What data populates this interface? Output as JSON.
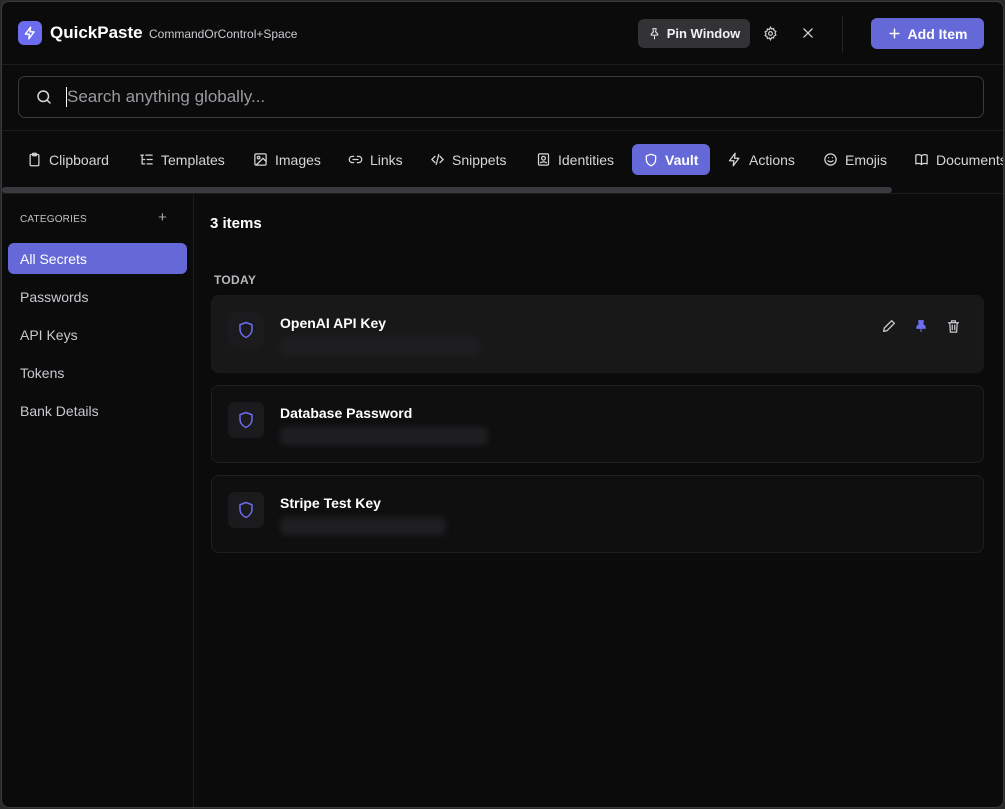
{
  "app": {
    "title": "QuickPaste",
    "hotkey": "CommandOrControl+Space"
  },
  "header": {
    "pin_label": "Pin Window",
    "add_label": "Add Item"
  },
  "search": {
    "placeholder": "Search anything globally..."
  },
  "tabs": [
    {
      "label": "Clipboard",
      "icon": "clipboard-icon"
    },
    {
      "label": "Templates",
      "icon": "list-tree-icon"
    },
    {
      "label": "Images",
      "icon": "image-icon"
    },
    {
      "label": "Links",
      "icon": "link-icon"
    },
    {
      "label": "Snippets",
      "icon": "code-icon"
    },
    {
      "label": "Identities",
      "icon": "id-card-icon"
    },
    {
      "label": "Vault",
      "icon": "shield-icon",
      "active": true
    },
    {
      "label": "Actions",
      "icon": "bolt-icon"
    },
    {
      "label": "Emojis",
      "icon": "smile-icon"
    },
    {
      "label": "Documents",
      "icon": "book-icon"
    }
  ],
  "sidebar": {
    "heading": "CATEGORIES",
    "add_symbol": "+",
    "items": [
      {
        "label": "All Secrets",
        "active": true
      },
      {
        "label": "Passwords"
      },
      {
        "label": "API Keys"
      },
      {
        "label": "Tokens"
      },
      {
        "label": "Bank Details"
      }
    ]
  },
  "main": {
    "count_label": "3 items",
    "group": "TODAY",
    "items": [
      {
        "title": "OpenAI API Key",
        "icon": "shield-icon"
      },
      {
        "title": "Database Password",
        "icon": "shield-icon"
      },
      {
        "title": "Stripe Test Key",
        "icon": "shield-icon"
      }
    ]
  },
  "colors": {
    "accent": "#6569d8",
    "background": "#0b0b0c",
    "pin_active": "#6c6cf0"
  }
}
